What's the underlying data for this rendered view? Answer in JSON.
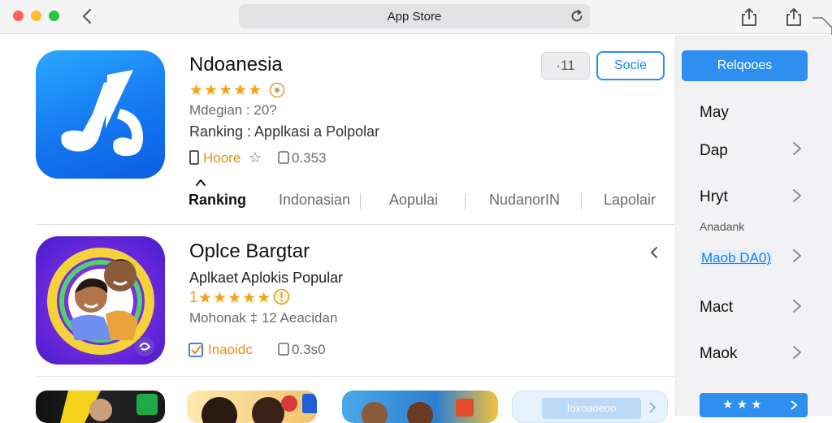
{
  "window": {
    "address_text": "App Store"
  },
  "apps": [
    {
      "title": "Ndoanesia",
      "stars": "★★★★★",
      "meta": "Mdegian : 20?",
      "ranking": "Ranking : Applkasi a Polpolar",
      "tag": "Hoore",
      "tag_star": "☆",
      "size": "0.353"
    },
    {
      "title": "Oplce Bargtar",
      "subtitle": "Aplkaet Aplokis Popular",
      "stars_prefix": "1",
      "stars": "★★★★★",
      "meta": "Mohonak ‡ 12 Aeacidan",
      "tag": "Inaoidc",
      "size": "0.3s0"
    }
  ],
  "header_buttons": {
    "gray_label": "·11",
    "outline_label": "Socie"
  },
  "tabs": [
    {
      "label": "Ranking"
    },
    {
      "label": "Indonasian"
    },
    {
      "label": "Aopulai"
    },
    {
      "label": "NudanorIN"
    },
    {
      "label": "Lapolair"
    }
  ],
  "sidebar": {
    "primary_button": "Relqooes",
    "items": [
      {
        "label": "May"
      },
      {
        "label": "Dap"
      },
      {
        "label": "Hryt"
      },
      {
        "label": "Mact"
      },
      {
        "label": "Maok"
      }
    ],
    "small_label": "Anadank",
    "link_label": "Maob DA0)",
    "bottom_label": "★ ★ ★"
  },
  "bottom_row": {
    "card_label": "Ioxoaoeoo"
  },
  "colors": {
    "accent": "#2f8ff0",
    "star": "#f5a312",
    "sidebar_bg": "#f2f2f4"
  }
}
